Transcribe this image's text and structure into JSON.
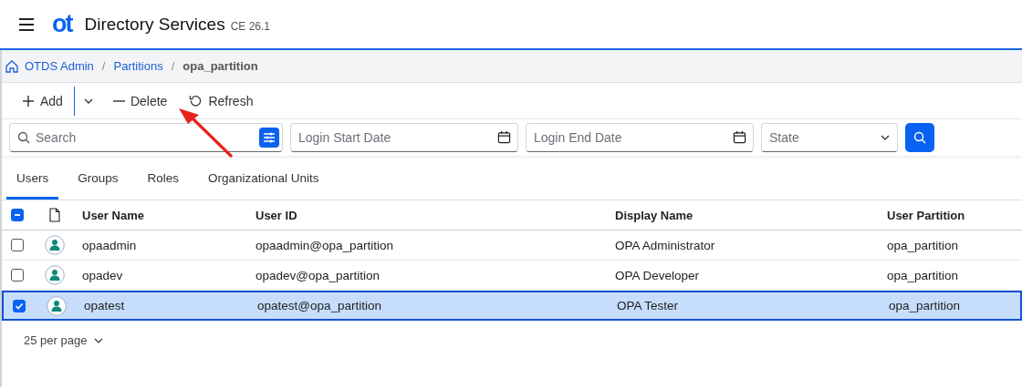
{
  "app": {
    "logo": "ot",
    "title": "Directory Services",
    "version": "CE 26.1"
  },
  "breadcrumb_separator": "/",
  "breadcrumb": [
    {
      "label": "OTDS Admin",
      "kind": "home"
    },
    {
      "label": "Partitions",
      "kind": "link"
    },
    {
      "label": "opa_partition",
      "kind": "current"
    }
  ],
  "toolbar": [
    {
      "label": "Add",
      "kind": "add"
    },
    {
      "kind": "menu"
    },
    {
      "label": "Delete",
      "kind": "delete"
    },
    {
      "label": "Refresh",
      "kind": "refresh"
    }
  ],
  "filters": {
    "search": {
      "placeholder": "Search"
    },
    "login_start": {
      "placeholder": "Login Start Date"
    },
    "login_end": {
      "placeholder": "Login End Date"
    },
    "state": {
      "placeholder": "State"
    }
  },
  "tabs": [
    {
      "label": "Users",
      "selected": true
    },
    {
      "label": "Groups",
      "selected": false
    },
    {
      "label": "Roles",
      "selected": false
    },
    {
      "label": "Organizational Units",
      "selected": false
    }
  ],
  "table": {
    "all_indeterminate": true,
    "columns": [
      "User Name",
      "User ID",
      "Display Name",
      "User Partition"
    ],
    "rows": [
      {
        "cells": [
          "opaadmin",
          "opaadmin@opa_partition",
          "OPA Administrator",
          "opa_partition"
        ],
        "selected": false
      },
      {
        "cells": [
          "opadev",
          "opadev@opa_partition",
          "OPA Developer",
          "opa_partition"
        ],
        "selected": false
      },
      {
        "cells": [
          "opatest",
          "opatest@opa_partition",
          "OPA Tester",
          "opa_partition"
        ],
        "selected": true
      }
    ]
  },
  "pagination": {
    "per_page": "25 per page"
  },
  "annotation": {
    "kind": "arrow"
  }
}
